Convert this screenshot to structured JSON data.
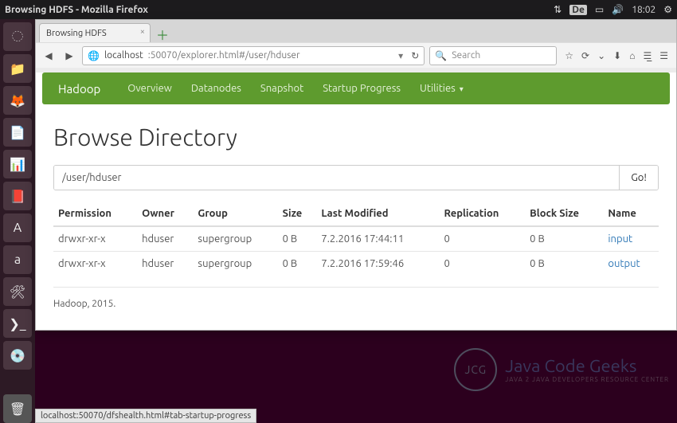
{
  "panel": {
    "window_title": "Browsing HDFS - Mozilla Firefox",
    "keyboard": "De",
    "clock": "18:02"
  },
  "firefox": {
    "tab_title": "Browsing HDFS",
    "url_host": "localhost",
    "url_rest": ":50070/explorer.html#/user/hduser",
    "search_placeholder": "Search"
  },
  "hadoop_nav": {
    "brand": "Hadoop",
    "items": [
      "Overview",
      "Datanodes",
      "Snapshot",
      "Startup Progress",
      "Utilities"
    ]
  },
  "page": {
    "title": "Browse Directory",
    "path_value": "/user/hduser",
    "go_label": "Go!",
    "columns": [
      "Permission",
      "Owner",
      "Group",
      "Size",
      "Last Modified",
      "Replication",
      "Block Size",
      "Name"
    ],
    "rows": [
      {
        "permission": "drwxr-xr-x",
        "owner": "hduser",
        "group": "supergroup",
        "size": "0 B",
        "modified": "7.2.2016 17:44:11",
        "replication": "0",
        "block_size": "0 B",
        "name": "input"
      },
      {
        "permission": "drwxr-xr-x",
        "owner": "hduser",
        "group": "supergroup",
        "size": "0 B",
        "modified": "7.2.2016 17:59:46",
        "replication": "0",
        "block_size": "0 B",
        "name": "output"
      }
    ],
    "footer": "Hadoop, 2015."
  },
  "statusbar": "localhost:50070/dfshealth.html#tab-startup-progress",
  "watermark": {
    "initials": "JCG",
    "title": "Java Code Geeks",
    "subtitle": "JAVA 2 JAVA DEVELOPERS RESOURCE CENTER"
  }
}
